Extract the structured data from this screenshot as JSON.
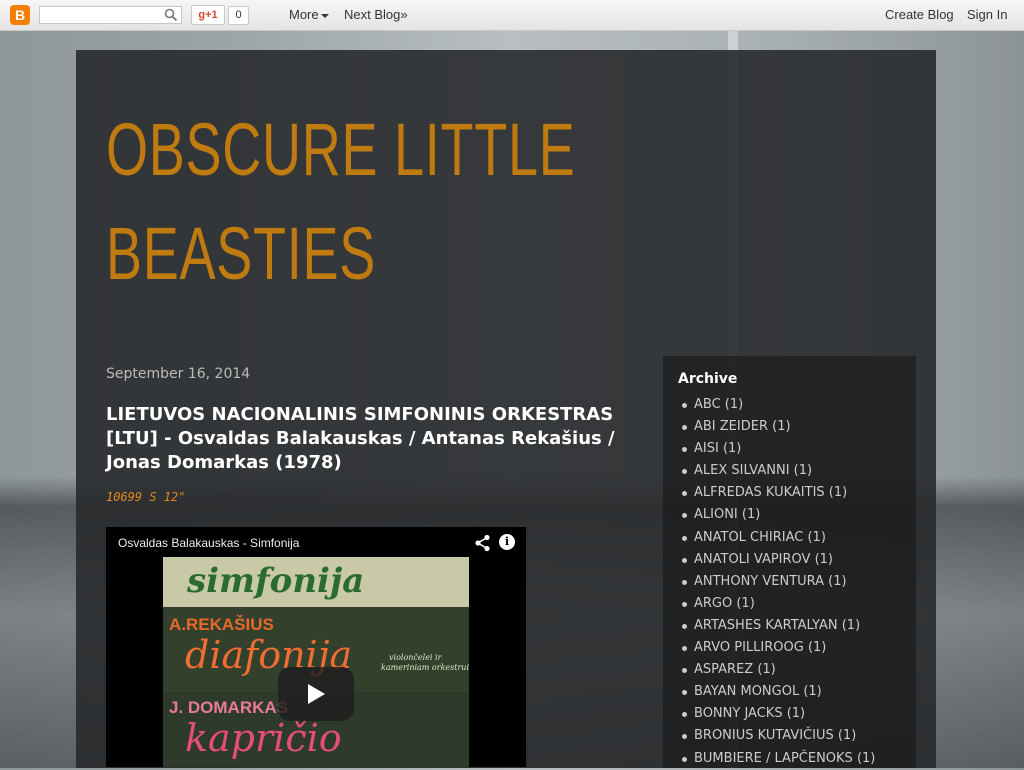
{
  "navbar": {
    "logo_glyph": "B",
    "search": {
      "value": "",
      "placeholder": ""
    },
    "gplus_label": "g+1",
    "gplus_count": "0",
    "more_label": "More",
    "next_blog_label": "Next Blog»",
    "create_blog_label": "Create Blog",
    "sign_in_label": "Sign In"
  },
  "blog": {
    "title_line1": "OBSCURE LITTLE",
    "title_line2": "BEASTIES"
  },
  "post": {
    "date": "September 16, 2014",
    "title": "LIETUVOS NACIONALINIS SIMFONINIS ORKESTRAS [LTU] - Osvaldas Balakauskas / Antanas Rekašius / Jonas Domarkas (1978)",
    "catalog_number": "10699 S 12\"",
    "video": {
      "title": "Osvaldas Balakauskas - Simfonija",
      "cover_line1": "simfonija",
      "cover_name2": "A.REKAŠIUS",
      "cover_line2": "diafonija",
      "cover_small1": "violončelei ir",
      "cover_small2": "kameriniam orkestrui",
      "cover_name3": "J. DOMARKAS",
      "cover_line3": "kapričio"
    }
  },
  "sidebar": {
    "title": "Archive",
    "items": [
      "ABC (1)",
      "ABI ZEIDER (1)",
      "AISI (1)",
      "ALEX SILVANNI (1)",
      "ALFREDAS KUKAITIS (1)",
      "ALIONI (1)",
      "ANATOL CHIRIAC (1)",
      "ANATOLI VAPIROV (1)",
      "ANTHONY VENTURA (1)",
      "ARGO (1)",
      "ARTASHES KARTALYAN (1)",
      "ARVO PILLIROOG (1)",
      "ASPAREZ (1)",
      "BAYAN MONGOL (1)",
      "BONNY JACKS (1)",
      "BRONIUS KUTAVIČIUS (1)",
      "BUMBIERE / LAPČENOKS (1)"
    ]
  },
  "colors": {
    "title_accent": "#c07b10",
    "catalog_accent": "#e08a1e",
    "panel_bg": "#282a2c"
  },
  "icons": [
    "blogger-logo-icon",
    "search-icon",
    "share-icon",
    "info-icon",
    "play-icon"
  ]
}
